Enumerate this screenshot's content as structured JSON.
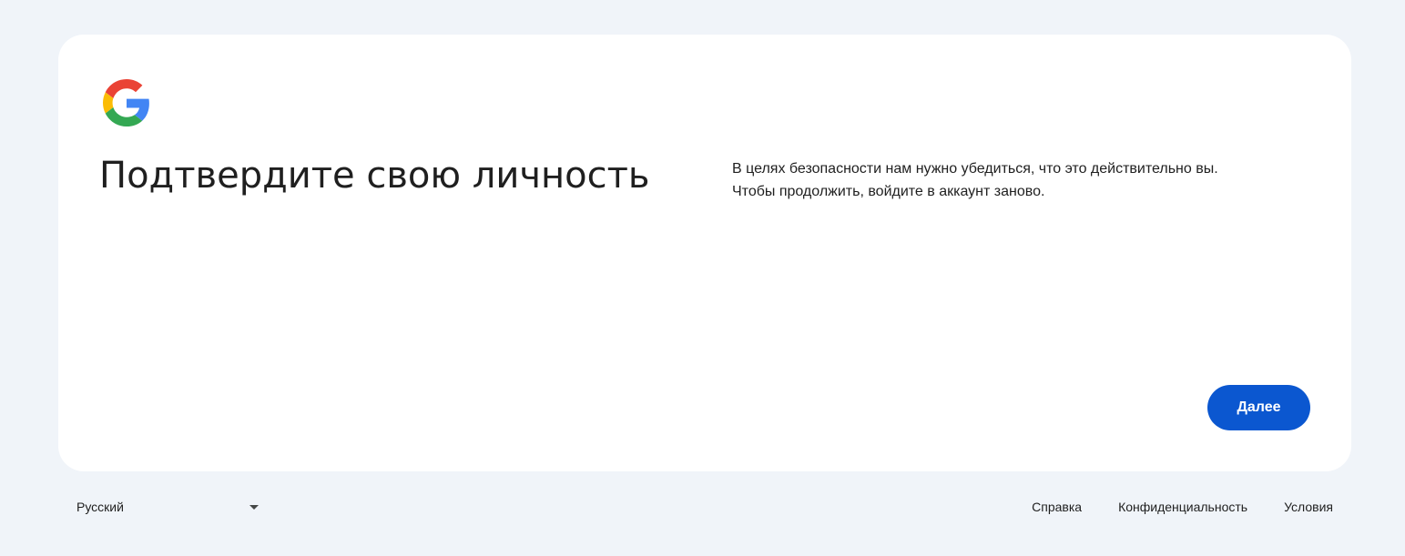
{
  "logo": {
    "icon": "google-g-icon",
    "colors": {
      "blue": "#4285F4",
      "red": "#EA4335",
      "yellow": "#FBBC05",
      "green": "#34A853"
    }
  },
  "main": {
    "title": "Подтвердите свою личность",
    "description_line1": "В целях безопасности нам нужно убедиться, что это действительно вы.",
    "description_line2": "Чтобы продолжить, войдите в аккаунт заново.",
    "next_button_label": "Далее",
    "accent_color": "#0b57d0"
  },
  "footer": {
    "language": "Русский",
    "links": {
      "help": "Справка",
      "privacy": "Конфиденциальность",
      "terms": "Условия"
    }
  }
}
